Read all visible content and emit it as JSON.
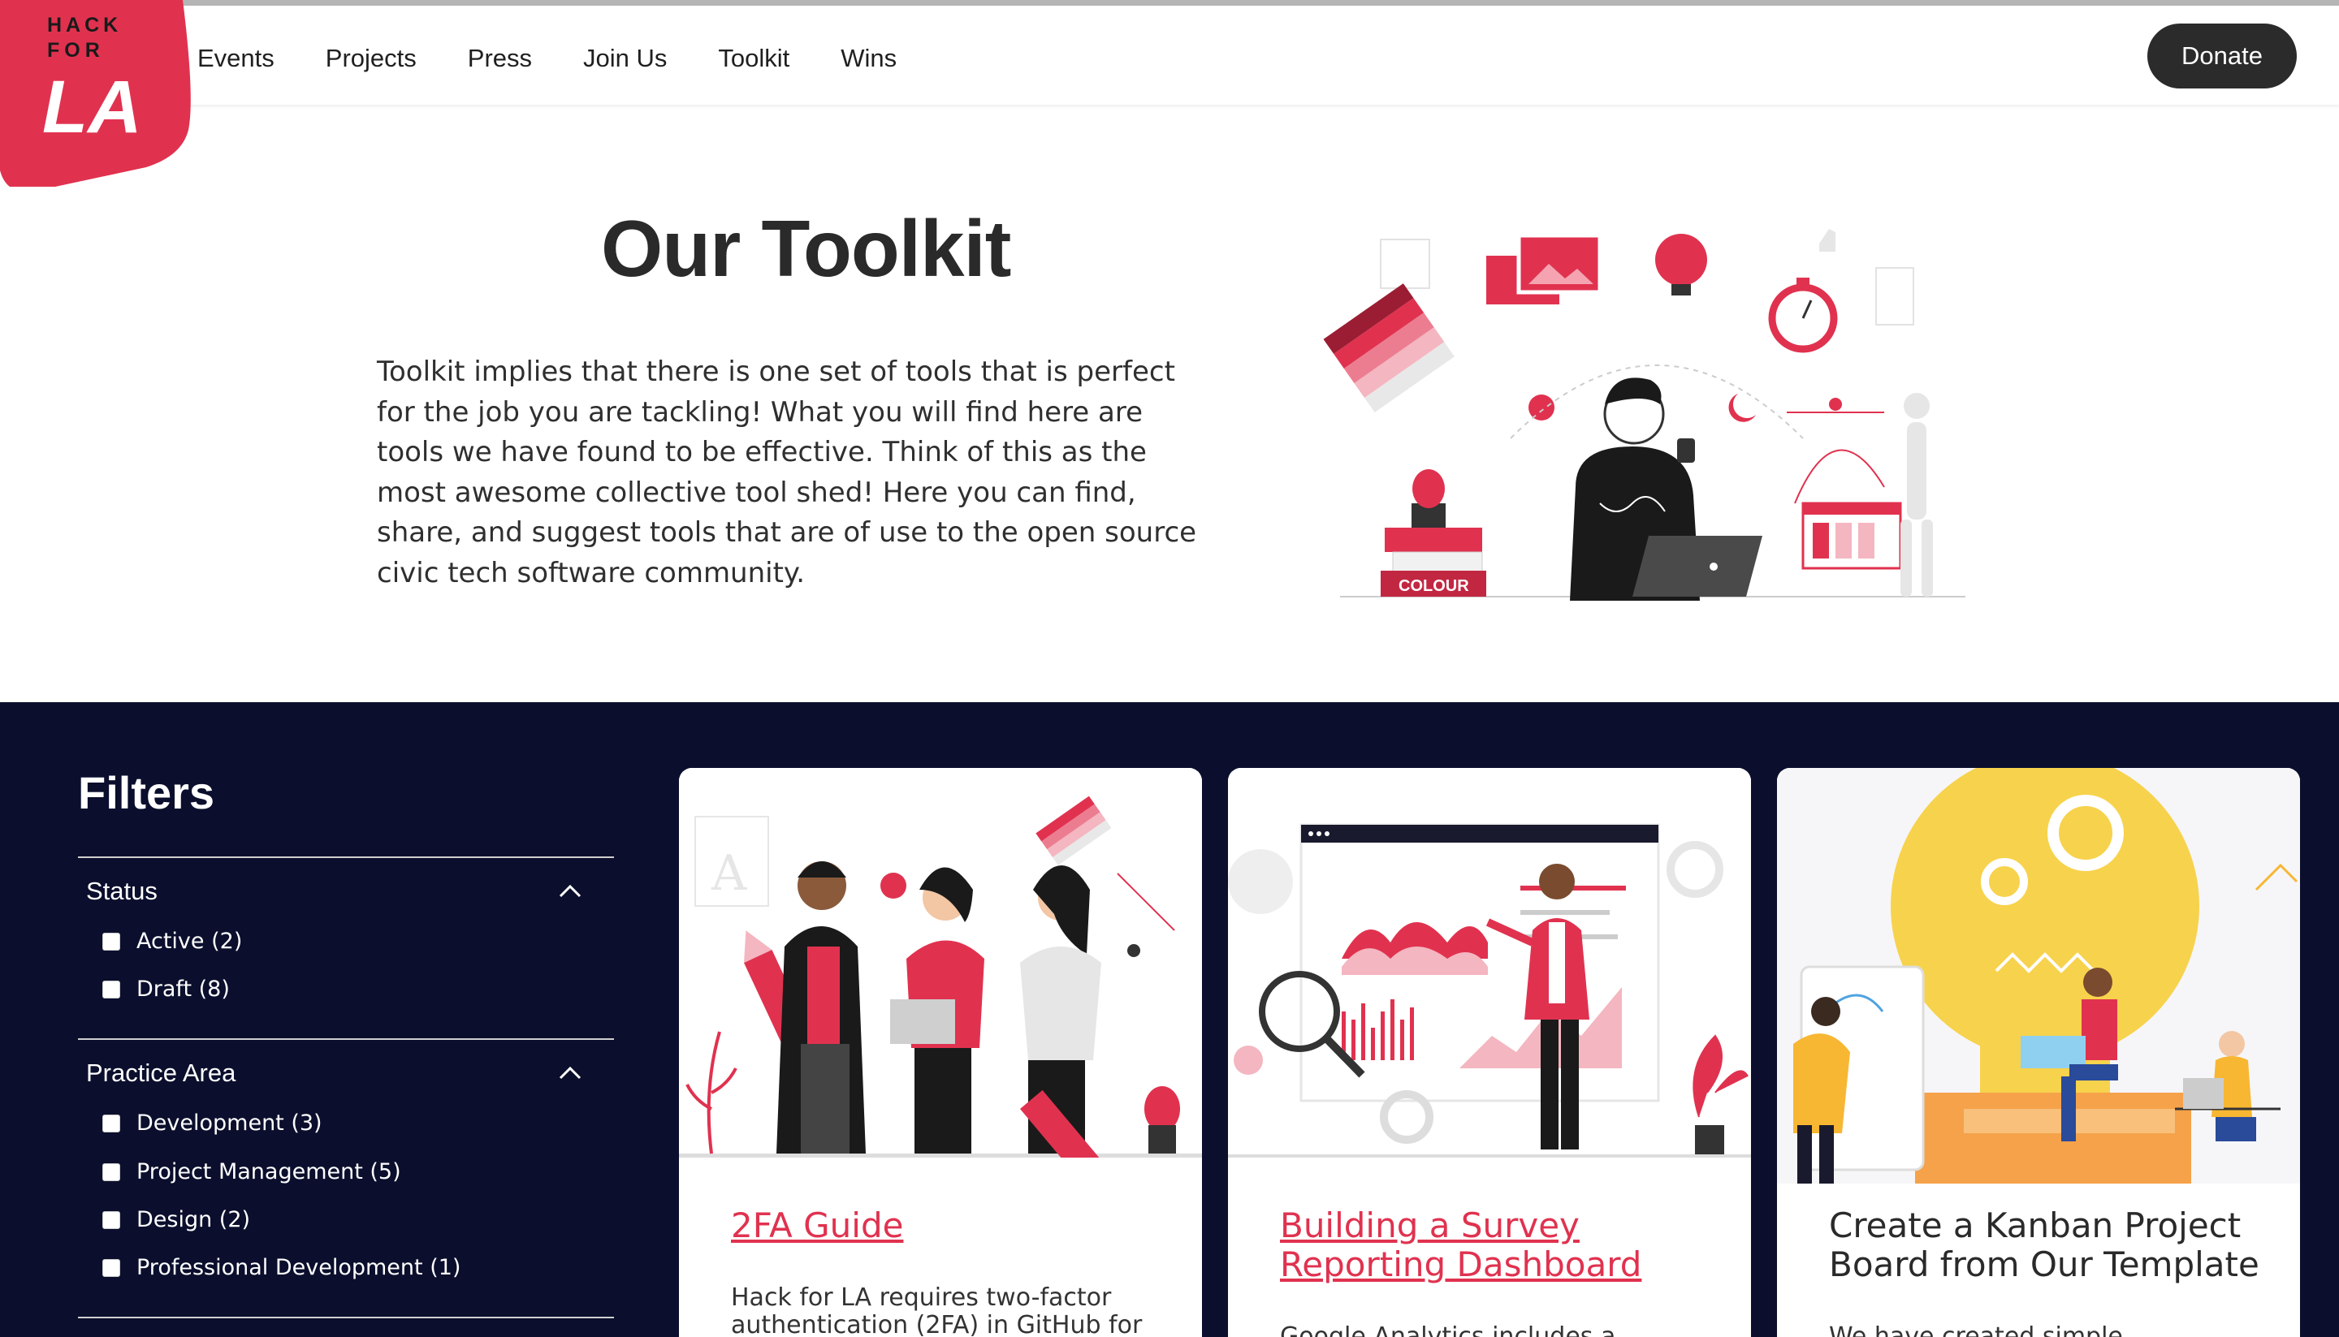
{
  "header": {
    "logo_text": [
      "HACK",
      "FOR",
      "LA"
    ],
    "nav": [
      "Events",
      "Projects",
      "Press",
      "Join Us",
      "Toolkit",
      "Wins"
    ],
    "donate_label": "Donate"
  },
  "hero": {
    "title": "Our Toolkit",
    "description": "Toolkit implies that there is one set of tools that is perfect for the job you are tackling! What you will find here are tools we have found to be effective. Think of this as the most awesome collective tool shed! Here you can find, share, and suggest tools that are of use to the open source civic tech software community.",
    "illustration_label": "COLOUR"
  },
  "filters": {
    "title": "Filters",
    "groups": [
      {
        "name": "Status",
        "options": [
          "Active (2)",
          "Draft (8)"
        ]
      },
      {
        "name": "Practice Area",
        "options": [
          "Development (3)",
          "Project Management (5)",
          "Design (2)",
          "Professional Development (1)"
        ]
      }
    ]
  },
  "cards": [
    {
      "title": "2FA Guide",
      "linked": true,
      "description": "Hack for LA requires two-factor authentication (2FA) in GitHub for"
    },
    {
      "title": "Building a Survey Reporting Dashboard",
      "linked": true,
      "description": "Google Analytics includes a number"
    },
    {
      "title": "Create a Kanban Project Board from Our Template",
      "linked": false,
      "description": "We have created simple templates"
    }
  ],
  "colors": {
    "brand_red": "#e0324f",
    "dark_bg": "#0b0f2d",
    "donate_bg": "#2b2b2b"
  }
}
